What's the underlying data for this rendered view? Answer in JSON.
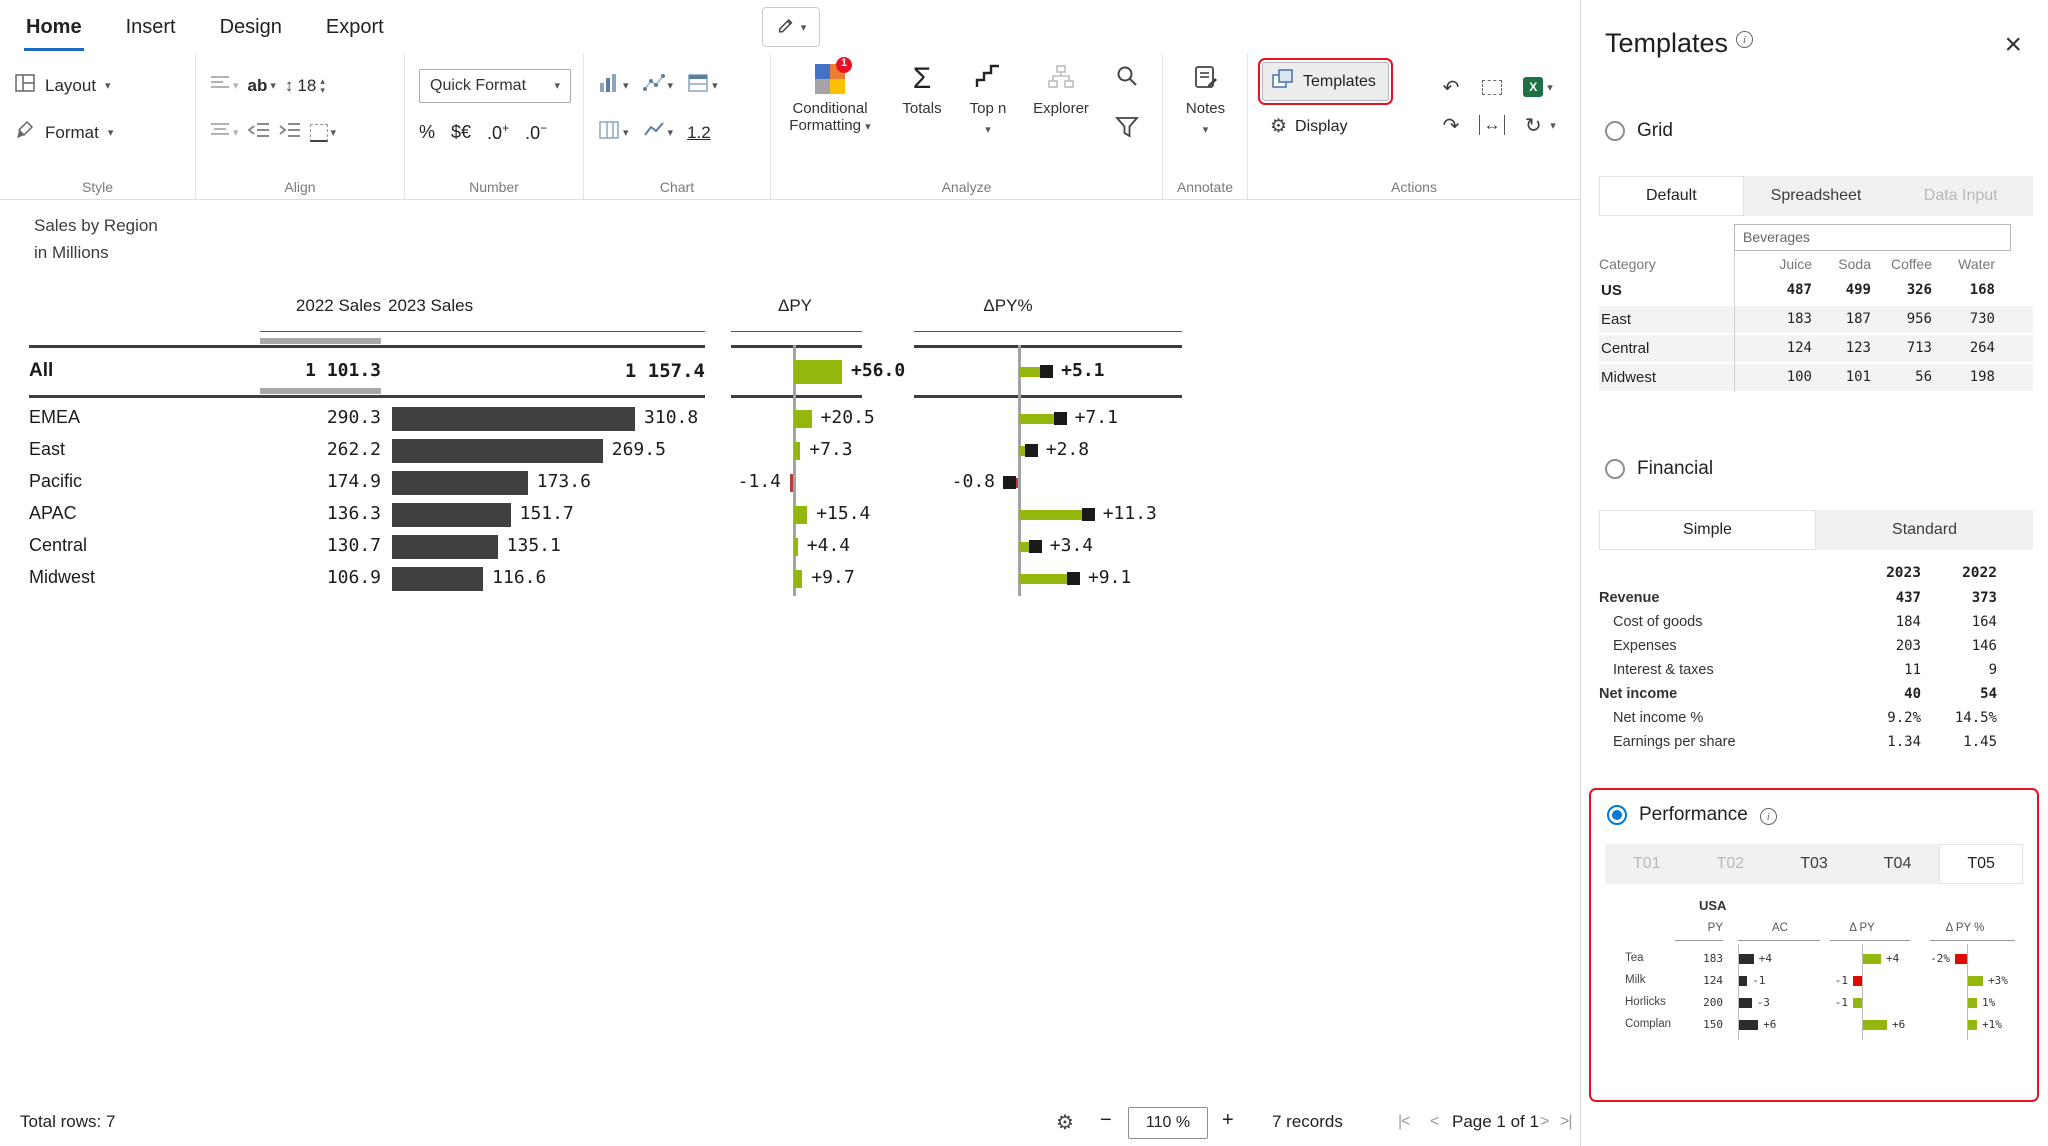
{
  "colors": {
    "green": "#93b70c",
    "red": "#b0413e",
    "red_bright": "#e00b00",
    "bar": "#404040",
    "gray_marker": "#a8a8a8",
    "axis_gray": "#a3a3a3",
    "line_dark": "#3d3d3d"
  },
  "icons": {
    "chevron_down": "▾",
    "chevron_up": "▴",
    "sigma": "Σ",
    "gear": "⚙",
    "undo": "↶",
    "redo": "↷",
    "refresh": "↻",
    "resize_h": "↔",
    "resize_v": "↕",
    "close": "×",
    "info": "i",
    "minus": "−",
    "plus": "+",
    "excel": "X",
    "badge_one": "1",
    "first_page": "|<",
    "prev_page": "<",
    "next_page": ">",
    "last_page": ">|",
    "ab": "ab"
  },
  "ribbon": {
    "tabs": [
      "Home",
      "Insert",
      "Design",
      "Export"
    ],
    "active_tab": "Home",
    "style": {
      "label": "Style",
      "layout": "Layout",
      "format": "Format"
    },
    "align": {
      "label": "Align",
      "font_size": "18"
    },
    "number": {
      "label": "Number",
      "quick_format": "Quick Format",
      "pct": "%",
      "cur": "$€",
      "dec": ".0",
      "dec_plus": "+",
      "dec_minus": "−"
    },
    "chart": {
      "label": "Chart",
      "one_two": "1.2"
    },
    "analyze": {
      "label": "Analyze",
      "conditional_line1": "Conditional",
      "conditional_line2": "Formatting",
      "totals": "Totals",
      "topn": "Top n",
      "explorer": "Explorer"
    },
    "annotate": {
      "label": "Annotate",
      "notes": "Notes"
    },
    "actions": {
      "label": "Actions",
      "templates": "Templates",
      "display": "Display"
    }
  },
  "chart_data": {
    "type": "table+bar",
    "title": "Sales by Region",
    "subtitle": "in Millions",
    "columns": [
      "2022 Sales",
      "2023 Sales",
      "ΔPY",
      "ΔPY%"
    ],
    "total_row": {
      "label": "All",
      "v2022": "1 101.3",
      "v2023": "1 157.4",
      "dpy": 56.0,
      "dpy_label": "+56.0",
      "dpp": 5.1,
      "dpp_label": "+5.1"
    },
    "rows": [
      {
        "label": "EMEA",
        "v2022": "290.3",
        "v2023": "310.8",
        "val2023": 310.8,
        "dpy": 20.5,
        "dpy_label": "+20.5",
        "dpp": 7.1,
        "dpp_label": "+7.1"
      },
      {
        "label": "East",
        "v2022": "262.2",
        "v2023": "269.5",
        "val2023": 269.5,
        "dpy": 7.3,
        "dpy_label": "+7.3",
        "dpp": 2.8,
        "dpp_label": "+2.8"
      },
      {
        "label": "Pacific",
        "v2022": "174.9",
        "v2023": "173.6",
        "val2023": 173.6,
        "dpy": -1.4,
        "dpy_label": "-1.4",
        "dpp": -0.8,
        "dpp_label": "-0.8"
      },
      {
        "label": "APAC",
        "v2022": "136.3",
        "v2023": "151.7",
        "val2023": 151.7,
        "dpy": 15.4,
        "dpy_label": "+15.4",
        "dpp": 11.3,
        "dpp_label": "+11.3"
      },
      {
        "label": "Central",
        "v2022": "130.7",
        "v2023": "135.1",
        "val2023": 135.1,
        "dpy": 4.4,
        "dpy_label": "+4.4",
        "dpp": 3.4,
        "dpp_label": "+3.4"
      },
      {
        "label": "Midwest",
        "v2022": "106.9",
        "v2023": "116.6",
        "val2023": 116.6,
        "dpy": 9.7,
        "dpy_label": "+9.7",
        "dpp": 9.1,
        "dpp_label": "+9.1"
      }
    ]
  },
  "panel": {
    "title": "Templates",
    "grid": {
      "label": "Grid",
      "tabs": [
        "Default",
        "Spreadsheet",
        "Data Input"
      ],
      "selected_tab": "Default",
      "disabled_tabs": [
        "Data Input"
      ],
      "table": {
        "span_header": "Beverages",
        "columns": [
          "Category",
          "Juice",
          "Soda",
          "Coffee",
          "Water"
        ],
        "rows": [
          {
            "name": "US",
            "bold": true,
            "values": [
              "487",
              "499",
              "326",
              "168"
            ]
          },
          {
            "name": "East",
            "bold": false,
            "values": [
              "183",
              "187",
              "956",
              "730"
            ]
          },
          {
            "name": "Central",
            "bold": false,
            "values": [
              "124",
              "123",
              "713",
              "264"
            ]
          },
          {
            "name": "Midwest",
            "bold": false,
            "values": [
              "100",
              "101",
              "56",
              "198"
            ]
          }
        ]
      }
    },
    "financial": {
      "label": "Financial",
      "tabs": [
        "Simple",
        "Standard"
      ],
      "selected_tab": "Simple",
      "disabled_tabs": [],
      "table": {
        "col_headers": [
          "2023",
          "2022"
        ],
        "rows": [
          {
            "name": "Revenue",
            "v1": "437",
            "v2": "373",
            "bold": true,
            "indent": false
          },
          {
            "name": "Cost of goods",
            "v1": "184",
            "v2": "164",
            "bold": false,
            "indent": true
          },
          {
            "name": "Expenses",
            "v1": "203",
            "v2": "146",
            "bold": false,
            "indent": true
          },
          {
            "name": "Interest & taxes",
            "v1": "11",
            "v2": "9",
            "bold": false,
            "indent": true
          },
          {
            "name": "Net income",
            "v1": "40",
            "v2": "54",
            "bold": true,
            "indent": false
          },
          {
            "name": "Net income %",
            "v1": "9.2%",
            "v2": "14.5%",
            "bold": false,
            "indent": true
          },
          {
            "name": "Earnings per share",
            "v1": "1.34",
            "v2": "1.45",
            "bold": false,
            "indent": true
          }
        ]
      }
    },
    "performance": {
      "label": "Performance",
      "tabs": [
        "T01",
        "T02",
        "T03",
        "T04",
        "T05"
      ],
      "selected_tab": "T05",
      "disabled_tabs": [
        "T01",
        "T02"
      ],
      "preview": {
        "title": "USA",
        "col_headers": [
          "PY",
          "AC",
          "Δ PY",
          "Δ PY %"
        ],
        "rows": [
          {
            "name": "Tea",
            "py": "183",
            "ac": 4,
            "ac_label": "+4",
            "dpy": 4,
            "dpy_label": "+4",
            "dpy_color": "green",
            "dpp": -2,
            "dpp_label": "-2%",
            "dpp_color": "red"
          },
          {
            "name": "Milk",
            "py": "124",
            "ac": -1,
            "ac_label": "-1",
            "dpy": -1,
            "dpy_label": "-1",
            "dpy_color": "red",
            "dpp": 3,
            "dpp_label": "+3%",
            "dpp_color": "green"
          },
          {
            "name": "Horlicks",
            "py": "200",
            "ac": -3,
            "ac_label": "-3",
            "dpy": -1,
            "dpy_label": "-1",
            "dpy_color": "green",
            "dpp": 1,
            "dpp_label": "1%",
            "dpp_color": "green"
          },
          {
            "name": "Complan",
            "py": "150",
            "ac": 6,
            "ac_label": "+6",
            "dpy": 6,
            "dpy_label": "+6",
            "dpy_color": "green",
            "dpp": 1,
            "dpp_label": "+1%",
            "dpp_color": "green"
          }
        ]
      }
    }
  },
  "statusbar": {
    "total_rows": "Total rows: 7",
    "zoom": "110 %",
    "records": "7 records",
    "page": "Page 1 of 1"
  }
}
